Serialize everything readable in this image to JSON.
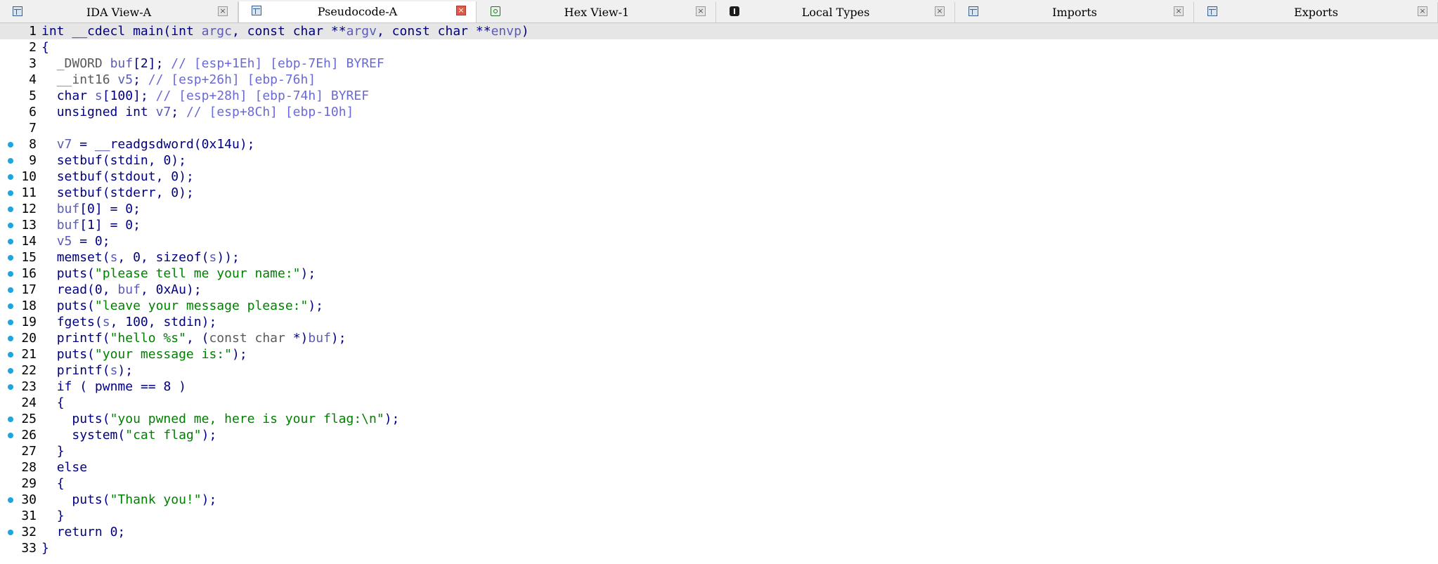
{
  "tabs": [
    {
      "label": "IDA View-A",
      "icon": "table-icon"
    },
    {
      "label": "Pseudocode-A",
      "icon": "table-icon",
      "active": true
    },
    {
      "label": "Hex View-1",
      "icon": "hex-icon"
    },
    {
      "label": "Local Types",
      "icon": "types-icon"
    },
    {
      "label": "Imports",
      "icon": "table-icon"
    },
    {
      "label": "Exports",
      "icon": "table-icon"
    }
  ],
  "close_glyph": "×",
  "code": {
    "lines": [
      {
        "num": "1",
        "dot": false,
        "text": "int __cdecl main(int argc, const char **argv, const char **envp)"
      },
      {
        "num": "2",
        "dot": false,
        "text": "{"
      },
      {
        "num": "3",
        "dot": false,
        "text": "  _DWORD buf[2]; // [esp+1Eh] [ebp-7Eh] BYREF"
      },
      {
        "num": "4",
        "dot": false,
        "text": "  __int16 v5; // [esp+26h] [ebp-76h]"
      },
      {
        "num": "5",
        "dot": false,
        "text": "  char s[100]; // [esp+28h] [ebp-74h] BYREF"
      },
      {
        "num": "6",
        "dot": false,
        "text": "  unsigned int v7; // [esp+8Ch] [ebp-10h]"
      },
      {
        "num": "7",
        "dot": false,
        "text": ""
      },
      {
        "num": "8",
        "dot": true,
        "text": "  v7 = __readgsdword(0x14u);"
      },
      {
        "num": "9",
        "dot": true,
        "text": "  setbuf(stdin, 0);"
      },
      {
        "num": "10",
        "dot": true,
        "text": "  setbuf(stdout, 0);"
      },
      {
        "num": "11",
        "dot": true,
        "text": "  setbuf(stderr, 0);"
      },
      {
        "num": "12",
        "dot": true,
        "text": "  buf[0] = 0;"
      },
      {
        "num": "13",
        "dot": true,
        "text": "  buf[1] = 0;"
      },
      {
        "num": "14",
        "dot": true,
        "text": "  v5 = 0;"
      },
      {
        "num": "15",
        "dot": true,
        "text": "  memset(s, 0, sizeof(s));"
      },
      {
        "num": "16",
        "dot": true,
        "text": "  puts(\"please tell me your name:\");"
      },
      {
        "num": "17",
        "dot": true,
        "text": "  read(0, buf, 0xAu);"
      },
      {
        "num": "18",
        "dot": true,
        "text": "  puts(\"leave your message please:\");"
      },
      {
        "num": "19",
        "dot": true,
        "text": "  fgets(s, 100, stdin);"
      },
      {
        "num": "20",
        "dot": true,
        "text": "  printf(\"hello %s\", (const char *)buf);"
      },
      {
        "num": "21",
        "dot": true,
        "text": "  puts(\"your message is:\");"
      },
      {
        "num": "22",
        "dot": true,
        "text": "  printf(s);"
      },
      {
        "num": "23",
        "dot": true,
        "text": "  if ( pwnme == 8 )"
      },
      {
        "num": "24",
        "dot": false,
        "text": "  {"
      },
      {
        "num": "25",
        "dot": true,
        "text": "    puts(\"you pwned me, here is your flag:\\n\");"
      },
      {
        "num": "26",
        "dot": true,
        "text": "    system(\"cat flag\");"
      },
      {
        "num": "27",
        "dot": false,
        "text": "  }"
      },
      {
        "num": "28",
        "dot": false,
        "text": "  else"
      },
      {
        "num": "29",
        "dot": false,
        "text": "  {"
      },
      {
        "num": "30",
        "dot": true,
        "text": "    puts(\"Thank you!\");"
      },
      {
        "num": "31",
        "dot": false,
        "text": "  }"
      },
      {
        "num": "32",
        "dot": true,
        "text": "  return 0;"
      },
      {
        "num": "33",
        "dot": false,
        "text": "}"
      }
    ]
  },
  "colors": {
    "keyword": "#000080",
    "variable": "#5b5bb8",
    "comment": "#6a6ad6",
    "string": "#008000",
    "breakpoint_dot": "#1aa7e0",
    "highlight": "#e6e6e6"
  }
}
